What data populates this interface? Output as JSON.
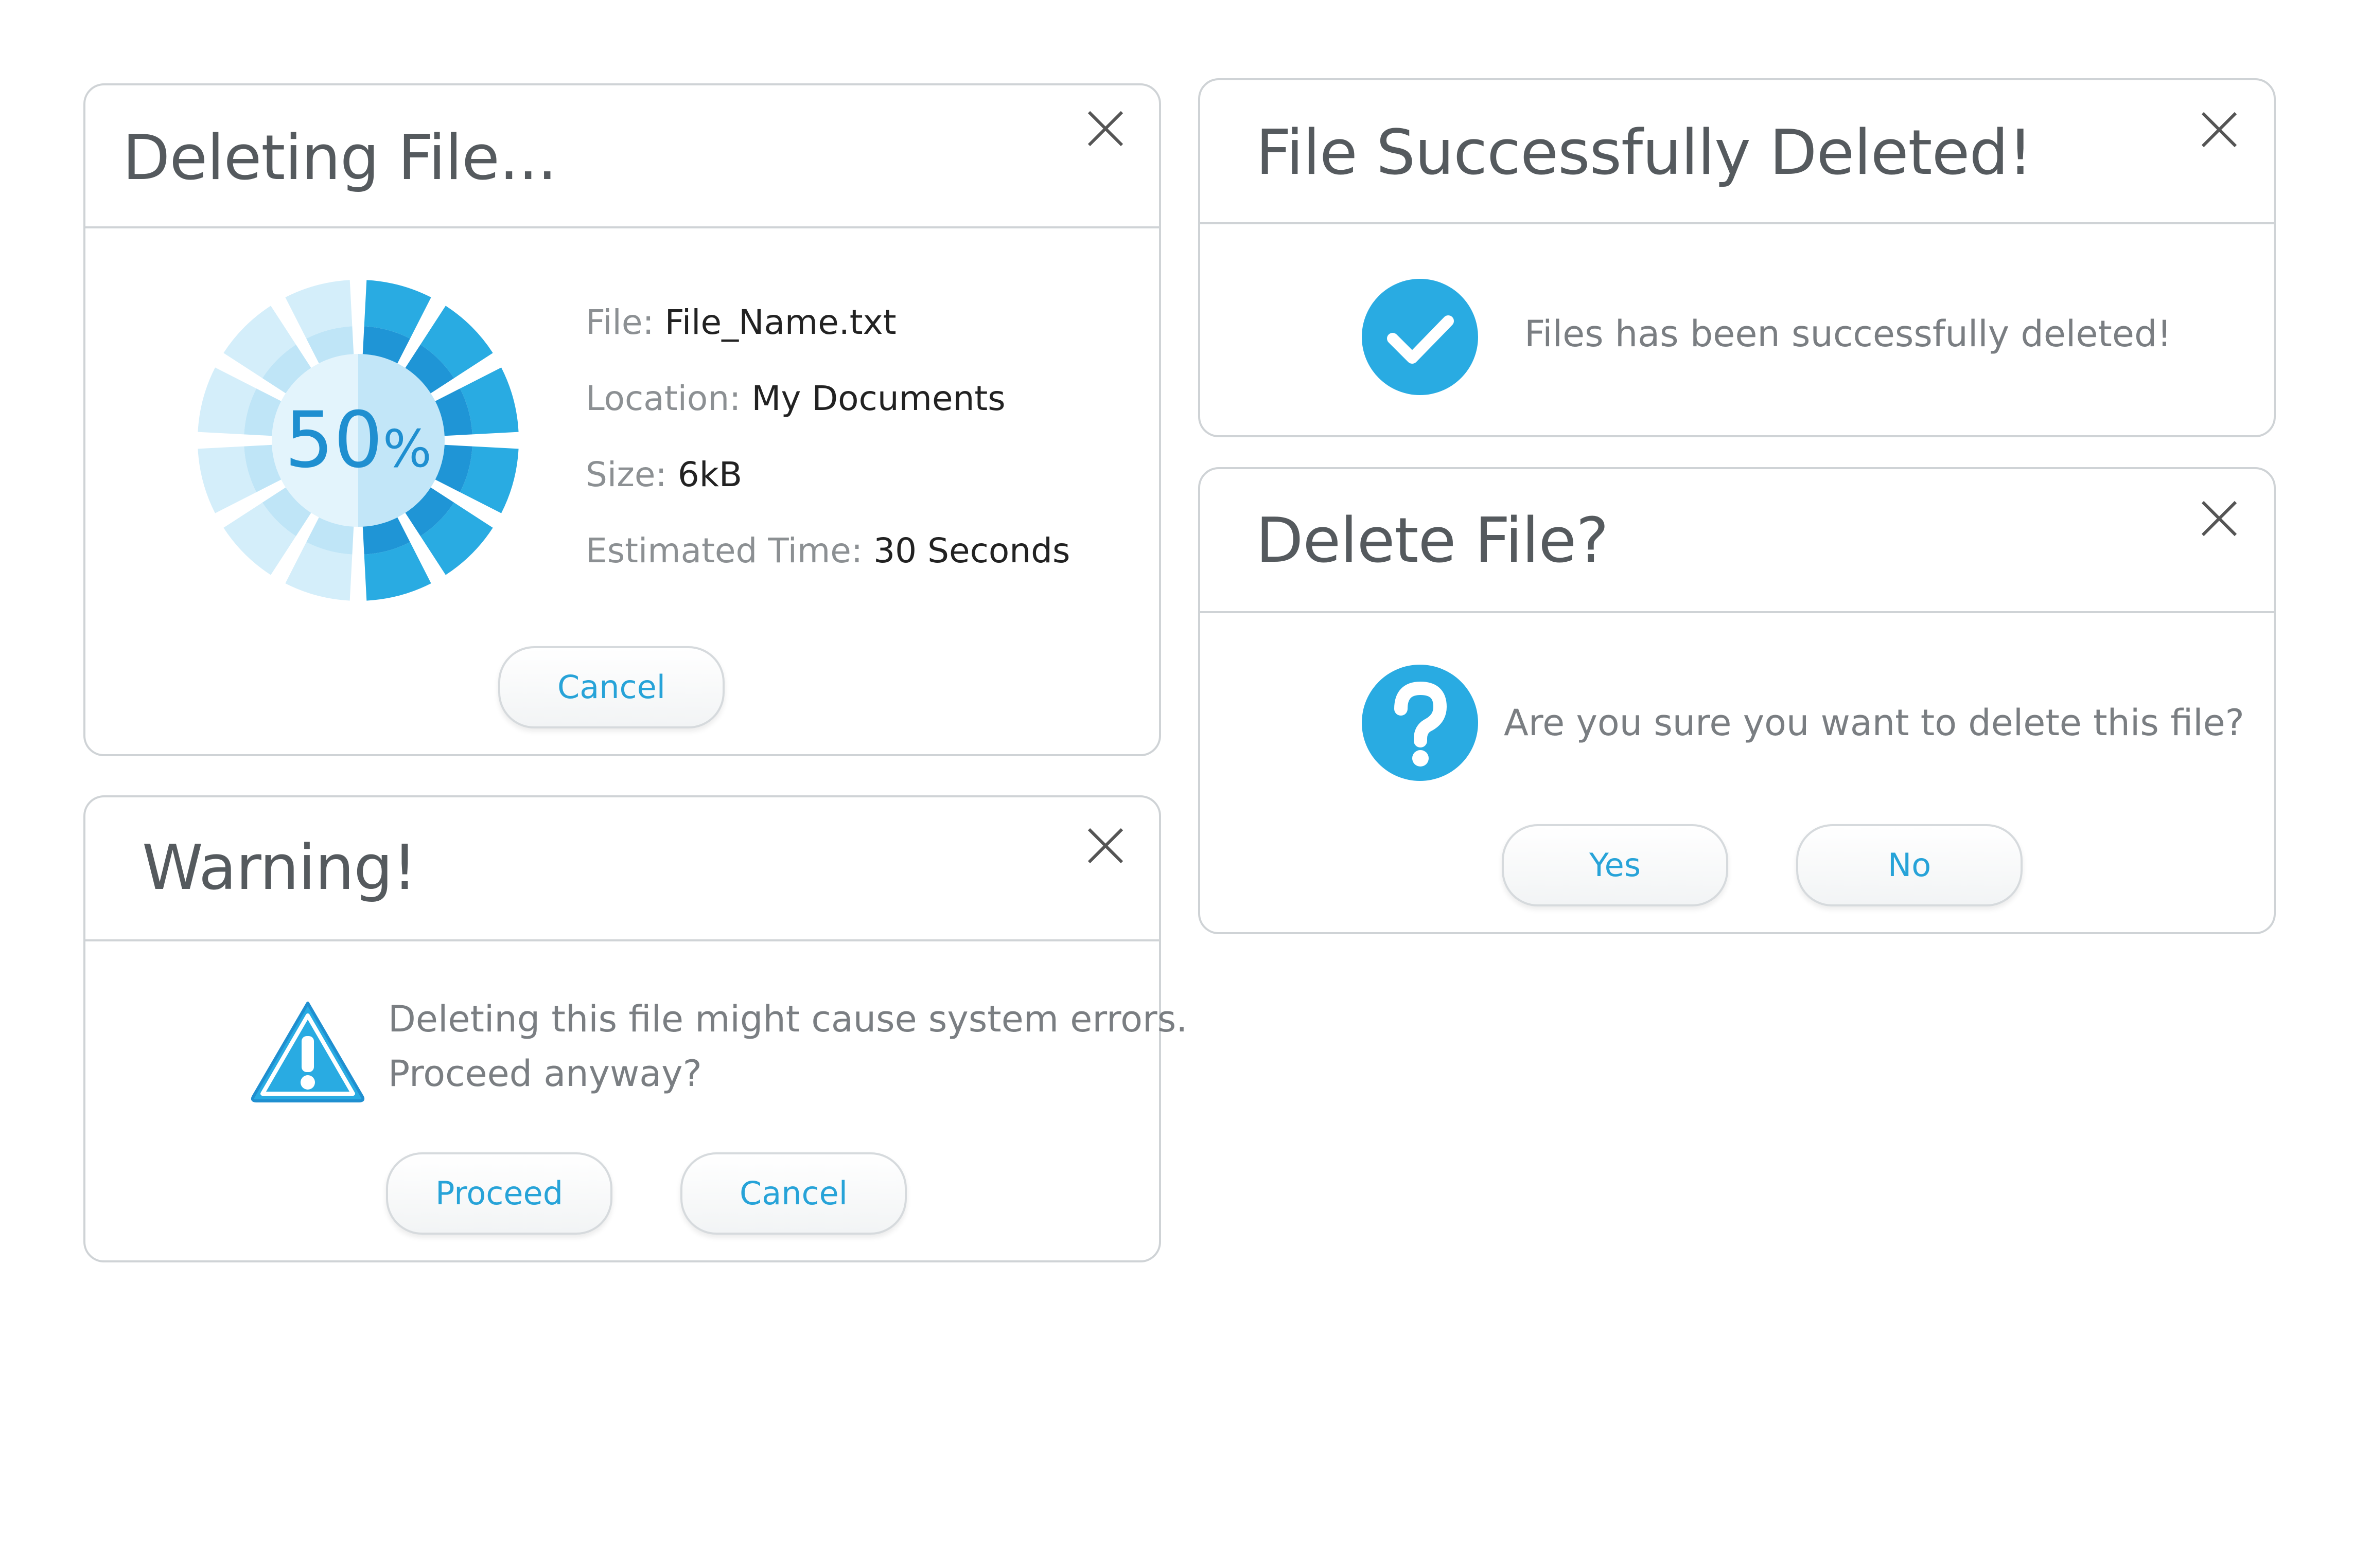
{
  "colors": {
    "accent": "#29abe2",
    "accent_dark": "#1f8fd0",
    "border": "#cfd3d6",
    "title_text": "#555a5e",
    "button_text": "#27a3d8"
  },
  "deleting_dialog": {
    "title": "Deleting File...",
    "progress": {
      "percent_value": "50",
      "percent_sign": "%",
      "fraction": 0.5
    },
    "file_label": "File:",
    "file_value": "File_Name.txt",
    "location_label": "Location:",
    "location_value": "My Documents",
    "size_label": "Size:",
    "size_value": "6kB",
    "time_label": "Estimated Time:",
    "time_value": "30 Seconds",
    "cancel_label": "Cancel",
    "close_icon": "close-icon"
  },
  "warning_dialog": {
    "title": "Warning!",
    "message_line1": "Deleting this file might cause system errors.",
    "message_line2": "Proceed anyway?",
    "proceed_label": "Proceed",
    "cancel_label": "Cancel",
    "icon": "warning-icon",
    "close_icon": "close-icon"
  },
  "success_dialog": {
    "title": "File Successfully Deleted!",
    "message": "Files has been successfully deleted!",
    "icon": "checkmark-icon",
    "close_icon": "close-icon"
  },
  "confirm_dialog": {
    "title": "Delete File?",
    "message": "Are you sure you want to delete this file?",
    "yes_label": "Yes",
    "no_label": "No",
    "icon": "question-icon",
    "close_icon": "close-icon"
  }
}
